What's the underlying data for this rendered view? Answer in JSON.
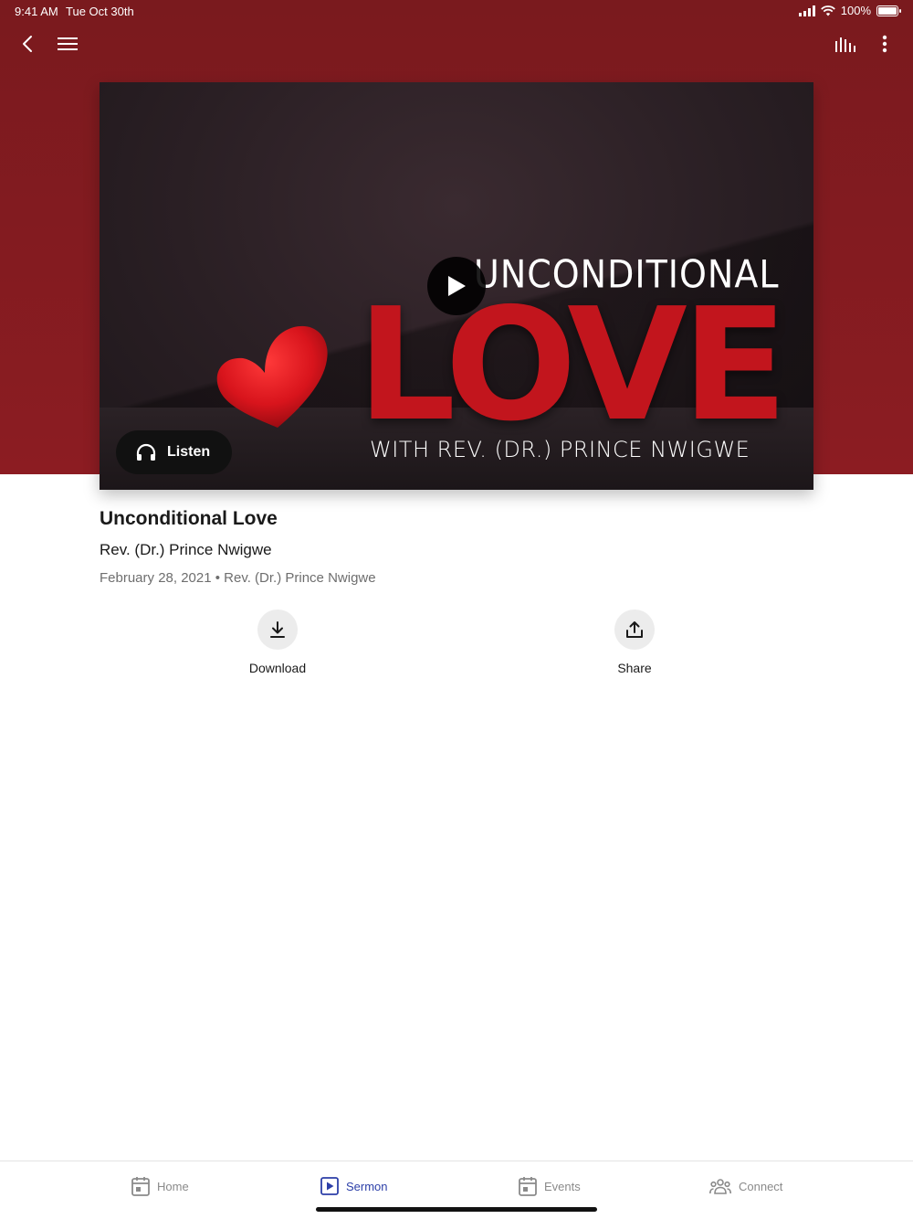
{
  "status_bar": {
    "time": "9:41 AM",
    "date": "Tue Oct 30th",
    "battery": "100%",
    "battery_level": 1.0
  },
  "nav": {
    "icons": [
      "back-icon",
      "menu-icon",
      "audio-bars-icon",
      "more-vertical-icon"
    ]
  },
  "hero": {
    "art_title": "UNCONDITIONAL",
    "art_love": "LOVE",
    "art_subtitle": "WITH REV. (DR.) PRINCE NWIGWE",
    "listen_label": "Listen"
  },
  "sermon": {
    "title": "Unconditional Love",
    "speaker": "Rev. (Dr.) Prince Nwigwe",
    "meta": "February 28, 2021 • Rev. (Dr.) Prince Nwigwe"
  },
  "actions": {
    "download_label": "Download",
    "share_label": "Share"
  },
  "tabs": [
    {
      "label": "Home",
      "icon": "calendar-icon",
      "active": false
    },
    {
      "label": "Sermon",
      "icon": "play-square-icon",
      "active": true
    },
    {
      "label": "Events",
      "icon": "calendar-icon",
      "active": false
    },
    {
      "label": "Connect",
      "icon": "people-icon",
      "active": false
    }
  ],
  "colors": {
    "header_red": "#7a1a1e",
    "active_tab": "#2c3fa8",
    "love_red": "#c2151d"
  }
}
